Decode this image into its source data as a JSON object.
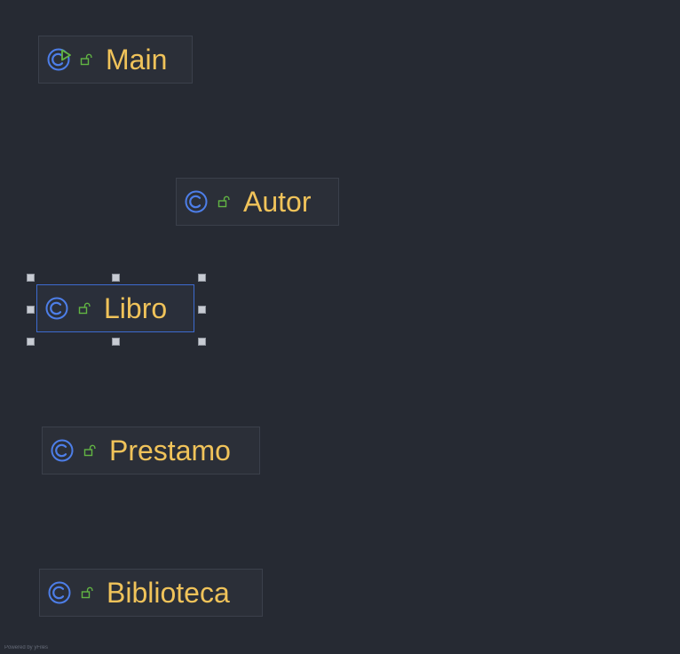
{
  "diagram": {
    "nodes": [
      {
        "label": "Main",
        "icon": "class-run-icon",
        "access_icon": "unlock-icon",
        "selected": false
      },
      {
        "label": "Autor",
        "icon": "class-icon",
        "access_icon": "unlock-icon",
        "selected": false
      },
      {
        "label": "Libro",
        "icon": "class-icon",
        "access_icon": "unlock-icon",
        "selected": true
      },
      {
        "label": "Prestamo",
        "icon": "class-icon",
        "access_icon": "unlock-icon",
        "selected": false
      },
      {
        "label": "Biblioteca",
        "icon": "class-icon",
        "access_icon": "unlock-icon",
        "selected": false
      }
    ]
  },
  "footer": {
    "powered_by": "Powered by yFiles"
  },
  "colors": {
    "background": "#262a33",
    "node_background": "#2b2f38",
    "node_border": "#3b404b",
    "selected_border": "#3d6bcf",
    "label": "#f0c35a",
    "class_icon": "#4d7ee8",
    "run_icon": "#62b543",
    "lock_icon": "#62b543",
    "handle": "#c7cbd3"
  }
}
